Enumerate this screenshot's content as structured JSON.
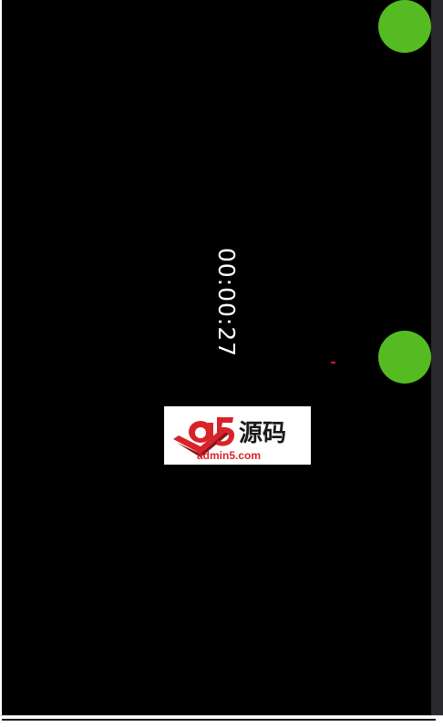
{
  "app": {
    "timer": {
      "value": "00:00:27"
    },
    "indicators": [
      {
        "name": "top",
        "color": "#55bb22"
      },
      {
        "name": "middle",
        "color": "#55bb22"
      }
    ],
    "watermark": {
      "brand_mark": "a5",
      "cn_text": "源码",
      "domain": "admin5.com",
      "colors": {
        "primary": "#d8232a",
        "accent": "#ffffff"
      }
    }
  }
}
